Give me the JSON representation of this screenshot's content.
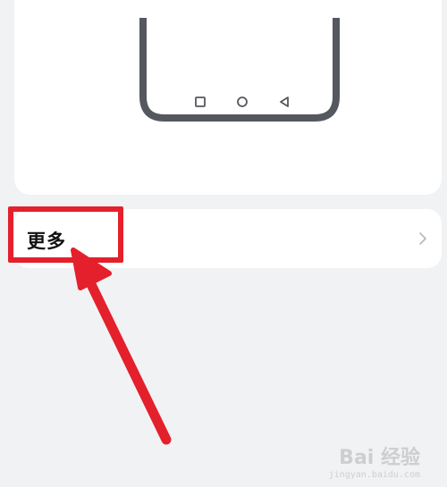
{
  "more_row": {
    "label": "更多",
    "chevron_icon": "chevron-right-icon"
  },
  "preview": {
    "nav_icons": [
      "square-recents-icon",
      "circle-home-icon",
      "triangle-back-icon"
    ]
  },
  "annotation": {
    "highlight_color": "#e3202b",
    "arrow_color": "#e3202b"
  },
  "watermark": {
    "brand": "Bai 经验",
    "url": "jingyan.baidu.com"
  }
}
